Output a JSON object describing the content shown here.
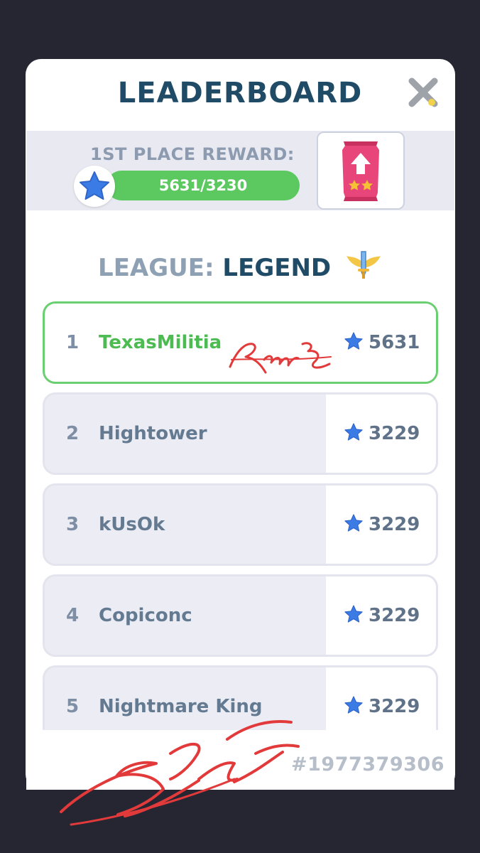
{
  "header": {
    "title": "LEADERBOARD"
  },
  "reward": {
    "label": "1ST PLACE REWARD:",
    "progress_text": "5631/3230",
    "progress_fraction": 1.0
  },
  "league": {
    "prefix": "LEAGUE:",
    "name": "LEGEND"
  },
  "players": [
    {
      "rank": "1",
      "name": "TexasMilitia",
      "score": "5631",
      "is_me": true
    },
    {
      "rank": "2",
      "name": "Hightower",
      "score": "3229",
      "is_me": false
    },
    {
      "rank": "3",
      "name": "kUsOk",
      "score": "3229",
      "is_me": false
    },
    {
      "rank": "4",
      "name": "Copiconc",
      "score": "3229",
      "is_me": false
    },
    {
      "rank": "5",
      "name": "Nightmare King",
      "score": "3229",
      "is_me": false
    }
  ],
  "footer": {
    "match_id": "#1977379306"
  },
  "icons": {
    "close": "close-icon",
    "star": "star-icon",
    "reward_pack": "reward-pack-icon",
    "league": "winged-sword-icon"
  },
  "colors": {
    "accent_green": "#5bc95f",
    "title": "#1f4b66",
    "star_blue": "#3b7be6",
    "pack_pink": "#e8457a"
  }
}
